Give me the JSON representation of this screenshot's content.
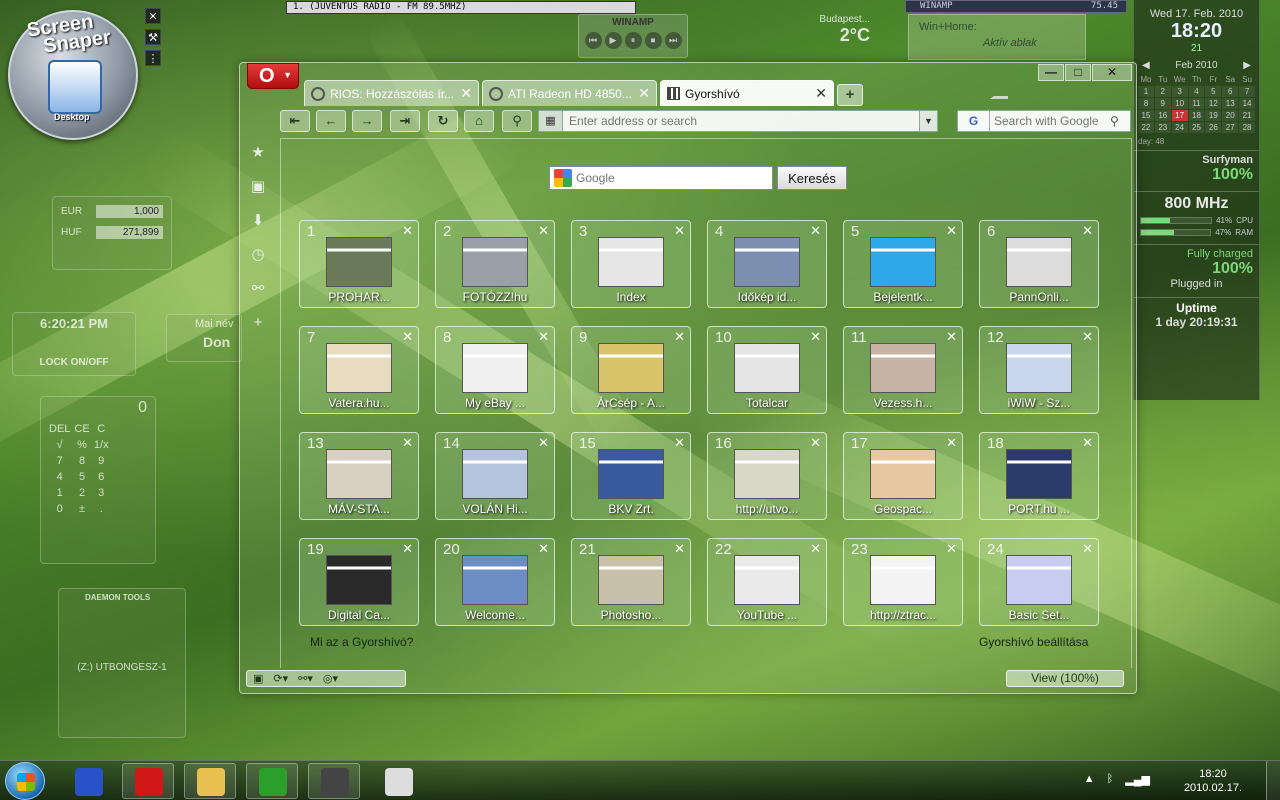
{
  "desktop": {
    "screen_snaper": {
      "title_line1": "Screen",
      "title_line2": "Snaper",
      "mode": "Desktop"
    },
    "radio_bar": "1.  (JUVENTUS RADIO - FM 89.5MHZ)",
    "winamp": {
      "title": "WINAMP",
      "controls": [
        "⏮",
        "▶",
        "⏸",
        "⏹",
        "⏭"
      ]
    },
    "weather": {
      "city": "Budapest...",
      "temp": "2°C"
    },
    "winamp_mini": {
      "title": "WINAMP",
      "value": "75.45"
    },
    "winhome": {
      "line1": "Win+Home:",
      "line2": "Aktív ablak"
    },
    "currency": {
      "rows": [
        {
          "code": "EUR",
          "value": "1,000"
        },
        {
          "code": "HUF",
          "value": "271,899"
        }
      ]
    },
    "clock_widget": {
      "time": "6:20:21 PM",
      "lock": "LOCK ON/OFF"
    },
    "nameday": {
      "label": "Mai név",
      "name": "Don"
    },
    "calculator": {
      "display": "0",
      "keys": [
        "DEL",
        "CE",
        "C",
        "√",
        "%",
        "1/x",
        "7",
        "8",
        "9",
        "4",
        "5",
        "6",
        "1",
        "2",
        "3",
        "0",
        "±",
        "."
      ]
    },
    "daemon": {
      "title": "DAEMON TOOLS",
      "drive": "(Z:) UTBONGESZ-1"
    }
  },
  "sidebar": {
    "date": "Wed 17. Feb. 2010",
    "time": "18:20",
    "week": "21",
    "calendar": {
      "month": "Feb 2010",
      "dow": [
        "Mo",
        "Tu",
        "We",
        "Th",
        "Fr",
        "Sa",
        "Su"
      ],
      "days": [
        "1",
        "2",
        "3",
        "4",
        "5",
        "6",
        "7",
        "8",
        "9",
        "10",
        "11",
        "12",
        "13",
        "14",
        "15",
        "16",
        "17",
        "18",
        "19",
        "20",
        "21",
        "22",
        "23",
        "24",
        "25",
        "26",
        "27",
        "28"
      ],
      "today": "17"
    },
    "day_of_year": "day: 48",
    "wifi": {
      "name": "Surfyman",
      "value": "100%"
    },
    "cpu": {
      "freq": "800 MHz",
      "cpu_pct": "41%",
      "cpu_label": "CPU",
      "cpu_fill": 0.41,
      "ram_pct": "47%",
      "ram_label": "RAM",
      "ram_fill": 0.47
    },
    "battery": {
      "status": "Fully charged",
      "value": "100%",
      "plugged": "Plugged in"
    },
    "uptime": {
      "title": "Uptime",
      "value": "1 day 20:19:31"
    }
  },
  "browser": {
    "tabs": [
      {
        "label": "RIOS: Hozzászólás ír...",
        "active": false
      },
      {
        "label": "ATI Radeon HD 4850...",
        "active": false
      },
      {
        "label": "Gyorshívó",
        "active": true
      }
    ],
    "window_controls": {
      "minimize": "—",
      "maximize": "□",
      "close": "✕"
    },
    "address": {
      "placeholder": "Enter address or search",
      "value": ""
    },
    "search": {
      "engine": "G",
      "placeholder": "Search with Google"
    },
    "google_box": {
      "placeholder": "Google",
      "button": "Keresés"
    },
    "speed_dial": [
      {
        "num": "1",
        "label": "PROHAR...",
        "color": "#6a7a5a"
      },
      {
        "num": "2",
        "label": "FOTÓZZ!hu",
        "color": "#9aa0a8"
      },
      {
        "num": "3",
        "label": "Index",
        "color": "#e6e6e6"
      },
      {
        "num": "4",
        "label": "Időkép id...",
        "color": "#7c8fb0"
      },
      {
        "num": "5",
        "label": "Bejelentk...",
        "color": "#2fa8e8"
      },
      {
        "num": "6",
        "label": "PannOnli...",
        "color": "#dcdcdc"
      },
      {
        "num": "7",
        "label": "Vatera.hu...",
        "color": "#e8dcc0"
      },
      {
        "num": "8",
        "label": "My eBay ...",
        "color": "#f0f0f0"
      },
      {
        "num": "9",
        "label": "ÁrCsép - A...",
        "color": "#d9c46a"
      },
      {
        "num": "10",
        "label": "Totalcar",
        "color": "#e4e4e4"
      },
      {
        "num": "11",
        "label": "Vezess.h...",
        "color": "#c8b4a4"
      },
      {
        "num": "12",
        "label": "iWiW - Sz...",
        "color": "#c9d6ee"
      },
      {
        "num": "13",
        "label": "MÁV-STA...",
        "color": "#d8d0c0"
      },
      {
        "num": "14",
        "label": "VOLÁN Hi...",
        "color": "#b4c4dc"
      },
      {
        "num": "15",
        "label": "BKV Zrt.",
        "color": "#3a5aa0"
      },
      {
        "num": "16",
        "label": "http://utvo...",
        "color": "#d8d8c8"
      },
      {
        "num": "17",
        "label": "Geospac...",
        "color": "#e8c8a0"
      },
      {
        "num": "18",
        "label": "PORT.hu ...",
        "color": "#2a3a6a"
      },
      {
        "num": "19",
        "label": "Digital Ca...",
        "color": "#2a2a2a"
      },
      {
        "num": "20",
        "label": "Welcome...",
        "color": "#6c8cc4"
      },
      {
        "num": "21",
        "label": "Photosho...",
        "color": "#c8c0a8"
      },
      {
        "num": "22",
        "label": "YouTube ...",
        "color": "#eaeaea"
      },
      {
        "num": "23",
        "label": "http://ztrac...",
        "color": "#f4f4f4"
      },
      {
        "num": "24",
        "label": "Basic Set...",
        "color": "#c8ccf0"
      }
    ],
    "speed_dial_help": "Mi az a Gyorshívó?",
    "speed_dial_config": "Gyorshívó beállítása",
    "view_zoom": "View (100%)"
  },
  "taskbar": {
    "clock_time": "18:20",
    "clock_date": "2010.02.17.",
    "apps": [
      {
        "name": "save-app",
        "color": "#2a52c8"
      },
      {
        "name": "opera-app",
        "color": "#d01818"
      },
      {
        "name": "mail-app",
        "color": "#e8c050"
      },
      {
        "name": "utorrent-app",
        "color": "#2aa02a"
      },
      {
        "name": "speaker-app",
        "color": "#444444"
      },
      {
        "name": "media-player-app",
        "color": "#dddddd"
      }
    ]
  }
}
